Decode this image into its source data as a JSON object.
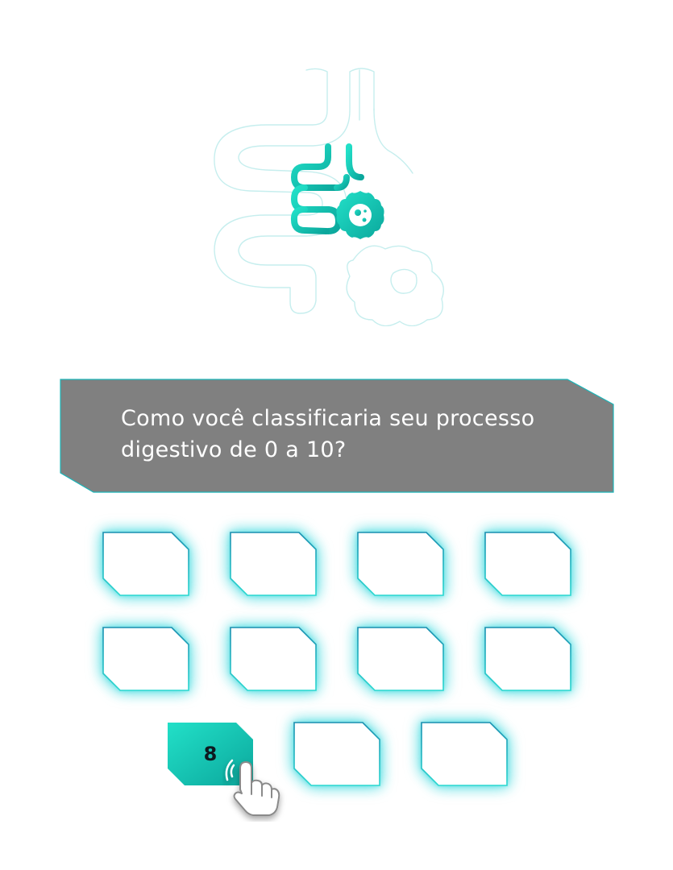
{
  "question": {
    "text": "Como você classificaria seu processo\ndigestivo de 0 a 10?"
  },
  "options": [
    "",
    "",
    "",
    "",
    "",
    "",
    "",
    "",
    "8",
    "",
    ""
  ],
  "selected_index": 8,
  "colors": {
    "card": "#808080",
    "card_border": "#1bb5b8",
    "accent_start": "#22e0c8",
    "accent_end": "#0ba79c",
    "option_border_top": "#1a8fb0",
    "option_border_bottom": "#2ad8d0",
    "icon_faint": "#bfeceb"
  },
  "icons": {
    "hero": "intestine-with-bacteria-icon",
    "cursor": "hand-pointer-icon"
  }
}
